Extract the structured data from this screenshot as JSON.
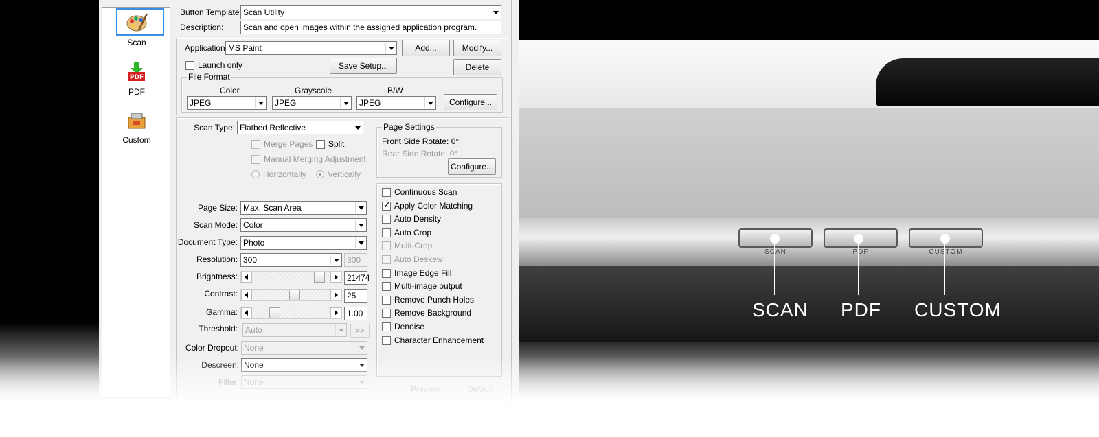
{
  "button_list": {
    "items": [
      {
        "label": "Scan",
        "icon": "palette-icon"
      },
      {
        "label": "PDF",
        "icon": "pdf-download-icon"
      },
      {
        "label": "Custom",
        "icon": "custom-toolbox-icon"
      }
    ],
    "selected": "Scan",
    "selection_color": "#3a8ee6"
  },
  "template": {
    "button_template_label": "Button Template:",
    "button_template_value": "Scan Utility",
    "description_label": "Description:",
    "description_value": "Scan and open images within the assigned application program."
  },
  "application": {
    "label": "Application:",
    "value": "MS Paint",
    "add_button": "Add...",
    "modify_button": "Modify...",
    "delete_button": "Delete",
    "launch_only_label": "Launch only",
    "launch_only_checked": false,
    "save_setup_button": "Save Setup..."
  },
  "file_format": {
    "title": "File Format",
    "color_label": "Color",
    "color_value": "JPEG",
    "grayscale_label": "Grayscale",
    "grayscale_value": "JPEG",
    "bw_label": "B/W",
    "bw_value": "JPEG",
    "configure_button": "Configure..."
  },
  "scan_settings": {
    "scan_type_label": "Scan Type:",
    "scan_type_value": "Flatbed Reflective",
    "merge_pages_label": "Merge Pages",
    "split_label": "Split",
    "manual_merging_label": "Manual Merging Adjustment",
    "horizontally_label": "Horizontally",
    "vertically_label": "Vertically",
    "page_size_label": "Page Size:",
    "page_size_value": "Max. Scan Area",
    "scan_mode_label": "Scan Mode:",
    "scan_mode_value": "Color",
    "document_type_label": "Document Type:",
    "document_type_value": "Photo",
    "resolution_label": "Resolution:",
    "resolution_value": "300",
    "resolution_custom": "300",
    "brightness_label": "Brightness:",
    "brightness_value": "21474",
    "brightness_level": 0.92,
    "contrast_label": "Contrast:",
    "contrast_value": "25",
    "contrast_level": 0.55,
    "gamma_label": "Gamma:",
    "gamma_value": "1.00",
    "gamma_level": 0.25,
    "threshold_label": "Threshold:",
    "threshold_value": "Auto",
    "threshold_more_button": ">>",
    "color_dropout_label": "Color Dropout:",
    "color_dropout_value": "None",
    "descreen_label": "Descreen:",
    "descreen_value": "None",
    "filter_label": "Filter:",
    "filter_value": "None"
  },
  "page_settings": {
    "title": "Page Settings",
    "front_rotate": "Front Side Rotate: 0°",
    "rear_rotate": "Rear Side Rotate: 0°",
    "configure_button": "Configure..."
  },
  "options": [
    {
      "label": "Continuous Scan",
      "checked": false,
      "enabled": true
    },
    {
      "label": "Apply Color Matching",
      "checked": true,
      "enabled": true
    },
    {
      "label": "Auto Density",
      "checked": false,
      "enabled": true
    },
    {
      "label": "Auto Crop",
      "checked": false,
      "enabled": true
    },
    {
      "label": "Multi-Crop",
      "checked": false,
      "enabled": false
    },
    {
      "label": "Auto Deskew",
      "checked": false,
      "enabled": false
    },
    {
      "label": "Image Edge Fill",
      "checked": false,
      "enabled": true
    },
    {
      "label": "Multi-image output",
      "checked": false,
      "enabled": true
    },
    {
      "label": "Remove Punch Holes",
      "checked": false,
      "enabled": true
    },
    {
      "label": "Remove Background",
      "checked": false,
      "enabled": true
    },
    {
      "label": "Denoise",
      "checked": false,
      "enabled": true
    },
    {
      "label": "Character Enhancement",
      "checked": false,
      "enabled": true
    }
  ],
  "footer": {
    "preview_button": "Preview",
    "default_button": "Default"
  },
  "scanner": {
    "button_captions": [
      "SCAN",
      "PDF",
      "CUSTOM"
    ],
    "callouts": [
      "SCAN",
      "PDF",
      "CUSTOM"
    ]
  }
}
